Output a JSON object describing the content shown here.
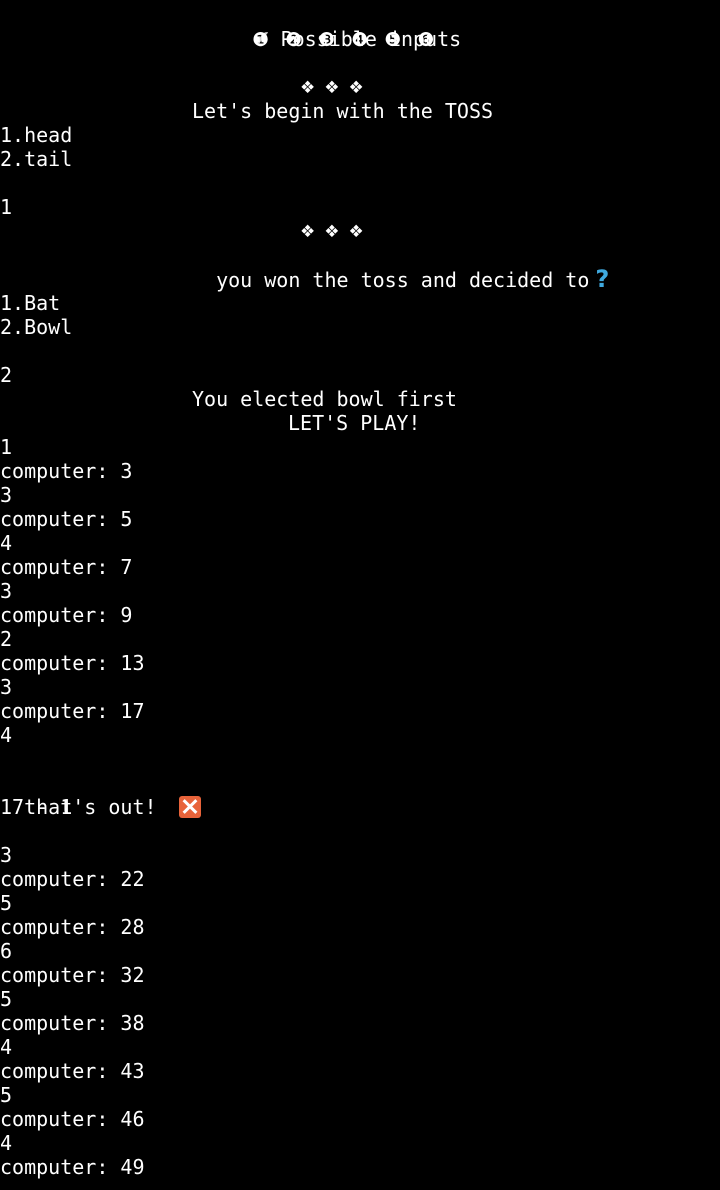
{
  "header": {
    "title": "Possible inputs",
    "digits": "❶ ❷ ❸ ❹ ❺ ❻",
    "colors": {
      "check": "#cfcfcf",
      "question": "#3fa9df",
      "cross": "#e8633a"
    }
  },
  "decorations": {
    "diamonds": "❖❖❖"
  },
  "toss": {
    "prompt": "Let's begin with the TOSS",
    "options": [
      "1.head",
      "2.tail"
    ],
    "input": "1"
  },
  "decision": {
    "prompt": "you won the toss and decided to",
    "options": [
      "1.Bat",
      "2.Bowl"
    ],
    "input": "2"
  },
  "elected": {
    "message": "You elected bowl first",
    "play": "LET'S PLAY!"
  },
  "innings1": [
    {
      "input": "1",
      "computer": "computer: 3"
    },
    {
      "input": "3",
      "computer": "computer: 5"
    },
    {
      "input": "4",
      "computer": "computer: 7"
    },
    {
      "input": "3",
      "computer": "computer: 9"
    },
    {
      "input": "2",
      "computer": "computer: 13"
    },
    {
      "input": "3",
      "computer": "computer: 17"
    },
    {
      "input": "4"
    }
  ],
  "out": {
    "message": "that's out!",
    "score": "17 - 1"
  },
  "innings2": [
    {
      "input": "3",
      "computer": "computer: 22"
    },
    {
      "input": "5",
      "computer": "computer: 28"
    },
    {
      "input": "6",
      "computer": "computer: 32"
    },
    {
      "input": "5",
      "computer": "computer: 38"
    },
    {
      "input": "4",
      "computer": "computer: 43"
    },
    {
      "input": "5",
      "computer": "computer: 46"
    },
    {
      "input": "4",
      "computer": "computer: 49"
    }
  ]
}
